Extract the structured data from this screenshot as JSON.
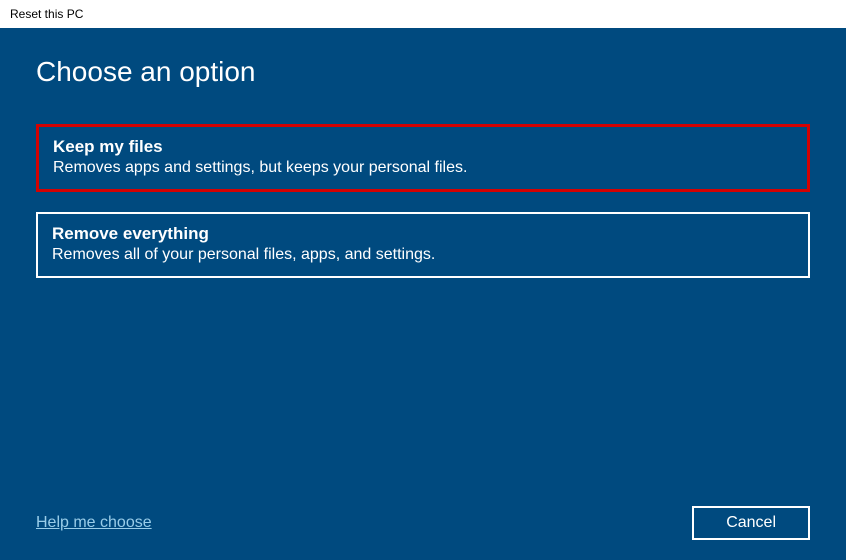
{
  "titlebar": {
    "text": "Reset this PC"
  },
  "dialog": {
    "heading": "Choose an option",
    "options": [
      {
        "title": "Keep my files",
        "description": "Removes apps and settings, but keeps your personal files."
      },
      {
        "title": "Remove everything",
        "description": "Removes all of your personal files, apps, and settings."
      }
    ],
    "help_link": "Help me choose",
    "cancel_label": "Cancel"
  }
}
